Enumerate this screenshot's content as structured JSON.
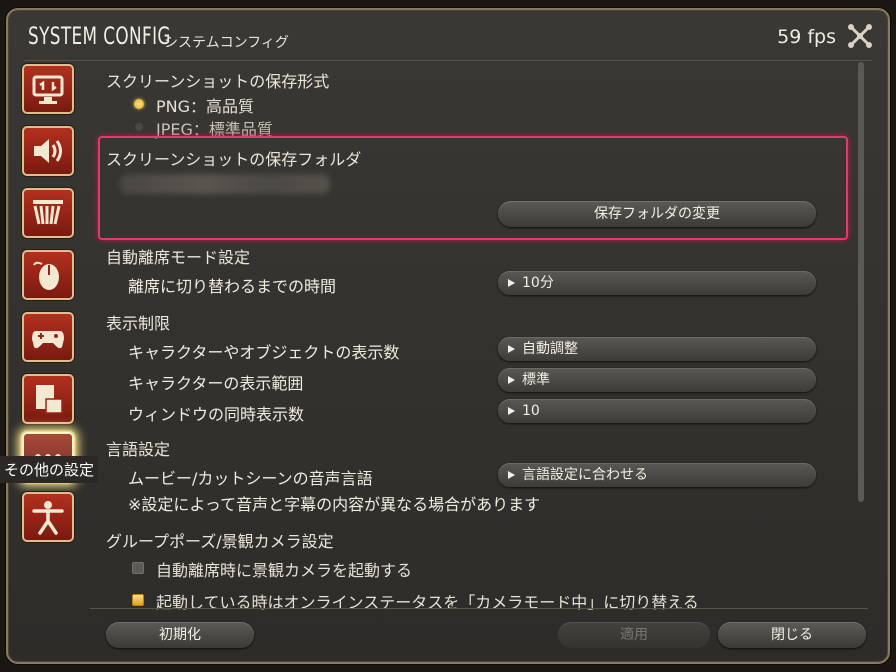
{
  "window": {
    "title": "SYSTEM CONFIG",
    "subtitle": "システムコンフィグ",
    "fps": "59 fps"
  },
  "sidebar": {
    "tooltip": "その他の設定",
    "items": [
      {
        "icon": "display-icon"
      },
      {
        "icon": "sound-icon"
      },
      {
        "icon": "theater-icon"
      },
      {
        "icon": "mouse-icon"
      },
      {
        "icon": "gamepad-icon"
      },
      {
        "icon": "document-icon"
      },
      {
        "icon": "more-icon",
        "active": true
      },
      {
        "icon": "accessibility-icon"
      }
    ]
  },
  "screenshot_format": {
    "heading": "スクリーンショットの保存形式",
    "options": [
      {
        "label": "PNG：高品質",
        "selected": true
      },
      {
        "label": "JPEG：標準品質",
        "selected": false
      }
    ]
  },
  "screenshot_folder": {
    "heading": "スクリーンショットの保存フォルダ",
    "change_button": "保存フォルダの変更"
  },
  "afk": {
    "heading": "自動離席モード設定",
    "time_label": "離席に切り替わるまでの時間",
    "time_value": "10分"
  },
  "display_limits": {
    "heading": "表示制限",
    "rows": [
      {
        "label": "キャラクターやオブジェクトの表示数",
        "value": "自動調整"
      },
      {
        "label": "キャラクターの表示範囲",
        "value": "標準"
      },
      {
        "label": "ウィンドウの同時表示数",
        "value": "10"
      }
    ]
  },
  "language": {
    "heading": "言語設定",
    "label": "ムービー/カットシーンの音声言語",
    "value": "言語設定に合わせる",
    "note": "※設定によって音声と字幕の内容が異なる場合があります"
  },
  "gpose": {
    "heading": "グループポーズ/景観カメラ設定",
    "options": [
      {
        "label": "自動離席時に景観カメラを起動する",
        "checked": false
      },
      {
        "label": "起動している時はオンラインステータスを「カメラモード中」に切り替える",
        "checked": true
      }
    ]
  },
  "footer": {
    "reset": "初期化",
    "apply": "適用",
    "close": "閉じる"
  },
  "colors": {
    "accent_highlight": "#e33a6a",
    "sidebar_button": "#b3301f",
    "radio_on": "#ffd05a"
  }
}
